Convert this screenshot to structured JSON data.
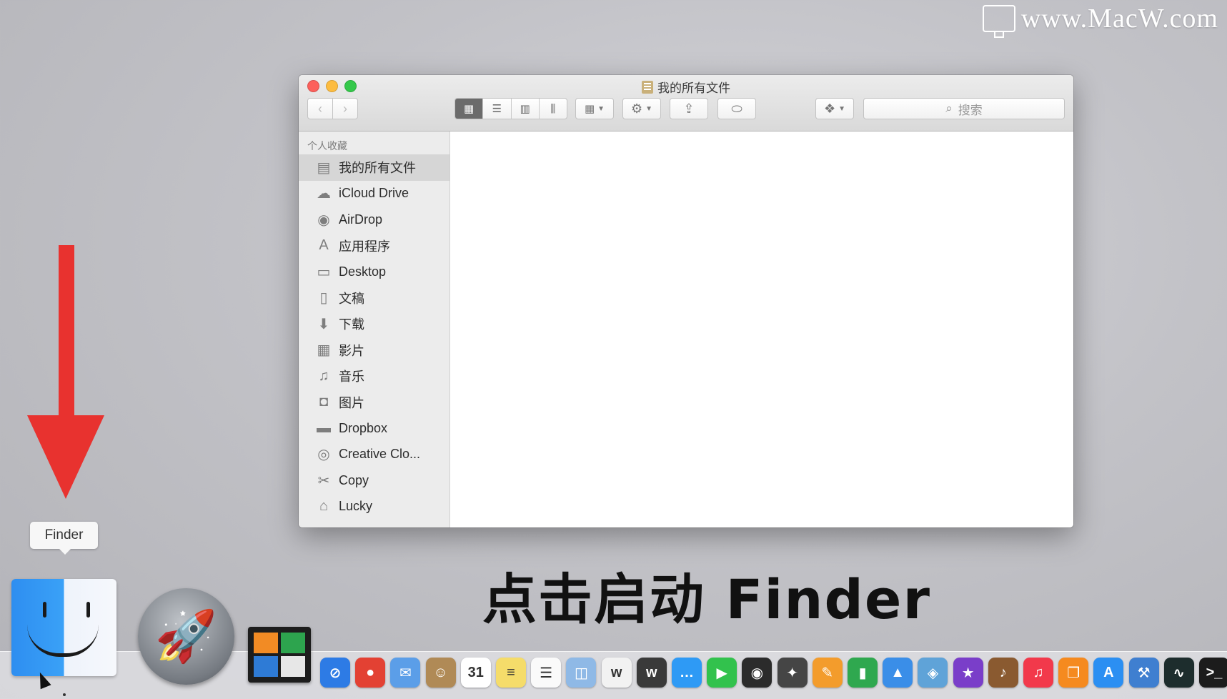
{
  "watermark": {
    "text": "www.MacW.com"
  },
  "window": {
    "title": "我的所有文件",
    "search_placeholder": "搜索",
    "sidebar": {
      "section": "个人收藏",
      "items": [
        {
          "label": "我的所有文件",
          "icon": "all-files-icon",
          "glyph": "▤",
          "selected": true
        },
        {
          "label": "iCloud Drive",
          "icon": "cloud-icon",
          "glyph": "☁"
        },
        {
          "label": "AirDrop",
          "icon": "airdrop-icon",
          "glyph": "◉"
        },
        {
          "label": "应用程序",
          "icon": "applications-icon",
          "glyph": "A"
        },
        {
          "label": "Desktop",
          "icon": "desktop-icon",
          "glyph": "▭"
        },
        {
          "label": "文稿",
          "icon": "documents-icon",
          "glyph": "▯"
        },
        {
          "label": "下载",
          "icon": "downloads-icon",
          "glyph": "⬇"
        },
        {
          "label": "影片",
          "icon": "movies-icon",
          "glyph": "▦"
        },
        {
          "label": "音乐",
          "icon": "music-icon",
          "glyph": "♫"
        },
        {
          "label": "图片",
          "icon": "pictures-icon",
          "glyph": "◘"
        },
        {
          "label": "Dropbox",
          "icon": "folder-icon",
          "glyph": "▬"
        },
        {
          "label": "Creative Clo...",
          "icon": "creative-cloud-icon",
          "glyph": "◎"
        },
        {
          "label": "Copy",
          "icon": "copy-icon",
          "glyph": "✂"
        },
        {
          "label": "Lucky",
          "icon": "home-icon",
          "glyph": "⌂"
        }
      ]
    }
  },
  "tooltip": "Finder",
  "caption": "点击启动 Finder",
  "dock": {
    "calendar_day": "31",
    "apps": [
      {
        "name": "safari-icon",
        "color": "#2d7be5",
        "glyph": "⊘"
      },
      {
        "name": "chrome-icon",
        "color": "#e34133",
        "glyph": "●"
      },
      {
        "name": "mail-icon",
        "color": "#5b9ee8",
        "glyph": "✉"
      },
      {
        "name": "contacts-icon",
        "color": "#b08a56",
        "glyph": "☺"
      },
      {
        "name": "calendar-icon",
        "color": "#ffffff",
        "glyph": "31"
      },
      {
        "name": "notes-icon",
        "color": "#f5dc6a",
        "glyph": "≡"
      },
      {
        "name": "reminders-icon",
        "color": "#fafafa",
        "glyph": "☰"
      },
      {
        "name": "preview-icon",
        "color": "#8fb9e6",
        "glyph": "◫"
      },
      {
        "name": "writer-icon",
        "color": "#f2f2f2",
        "glyph": "w"
      },
      {
        "name": "writer-dark-icon",
        "color": "#3a3a3a",
        "glyph": "w"
      },
      {
        "name": "messages-icon",
        "color": "#2e9af5",
        "glyph": "…"
      },
      {
        "name": "facetime-icon",
        "color": "#32c24d",
        "glyph": "▶"
      },
      {
        "name": "photo-booth-icon",
        "color": "#2b2b2b",
        "glyph": "◉"
      },
      {
        "name": "final-cut-icon",
        "color": "#454545",
        "glyph": "✦"
      },
      {
        "name": "pages-icon",
        "color": "#f39c2c",
        "glyph": "✎"
      },
      {
        "name": "numbers-icon",
        "color": "#2fa84f",
        "glyph": "▮"
      },
      {
        "name": "keynote-icon",
        "color": "#3a8ee8",
        "glyph": "▲"
      },
      {
        "name": "iphoto-icon",
        "color": "#5fa3d8",
        "glyph": "◈"
      },
      {
        "name": "imovie-icon",
        "color": "#7a3ec9",
        "glyph": "★"
      },
      {
        "name": "garageband-icon",
        "color": "#8a5a30",
        "glyph": "♪"
      },
      {
        "name": "itunes-icon",
        "color": "#f2394b",
        "glyph": "♫"
      },
      {
        "name": "ibooks-icon",
        "color": "#f58a1f",
        "glyph": "❐"
      },
      {
        "name": "app-store-icon",
        "color": "#2b8ff2",
        "glyph": "A"
      },
      {
        "name": "xcode-icon",
        "color": "#3f7fd0",
        "glyph": "⚒"
      },
      {
        "name": "activity-monitor-icon",
        "color": "#1d2d2d",
        "glyph": "∿"
      },
      {
        "name": "terminal-icon",
        "color": "#1c1c1c",
        "glyph": ">_"
      }
    ]
  }
}
